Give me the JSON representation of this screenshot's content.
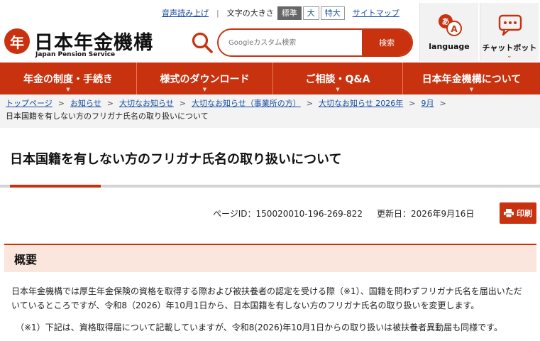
{
  "header": {
    "logo_mark": "年",
    "logo_text": "日本年金機構",
    "logo_sub": "Japan Pension Service",
    "util": {
      "read_aloud": "音声読み上げ",
      "font_size_label": "文字の大きさ",
      "font_sizes": [
        "標準",
        "大",
        "特大"
      ],
      "active_font_size": "標準",
      "sitemap": "サイトマップ"
    },
    "search": {
      "placeholder": "Googleカスタム検索",
      "button": "検索"
    },
    "language_label": "language",
    "chatbot_label": "チャットボット",
    "brand_color": "#c8320f"
  },
  "nav": {
    "items": [
      "年金の制度・手続き",
      "様式のダウンロード",
      "ご相談・Q&A",
      "日本年金機構について"
    ]
  },
  "breadcrumb": {
    "items": [
      "トップページ",
      "お知らせ",
      "大切なお知らせ",
      "大切なお知らせ（事業所の方）",
      "大切なお知らせ 2026年",
      "9月"
    ],
    "current": "日本国籍を有しない方のフリガナ氏名の取り扱いについて"
  },
  "page": {
    "title": "日本国籍を有しない方のフリガナ氏名の取り扱いについて",
    "page_id": "ページID：150020010-196-269-822",
    "updated": "更新日：2026年9月16日",
    "print_label": "印刷"
  },
  "section": {
    "heading": "概要",
    "body": "日本年金機構では厚生年金保険の資格を取得する際および被扶養者の認定を受ける際（※1）、国籍を問わずフリガナ氏名を届出いただいているところですが、令和8（2026）年10月1日から、日本国籍を有しない方のフリガナ氏名の取り扱いを変更します。",
    "note": "（※1）下記は、資格取得届について記載していますが、令和8(2026)年10月1日からの取り扱いは被扶養者異動届も同様です。"
  }
}
